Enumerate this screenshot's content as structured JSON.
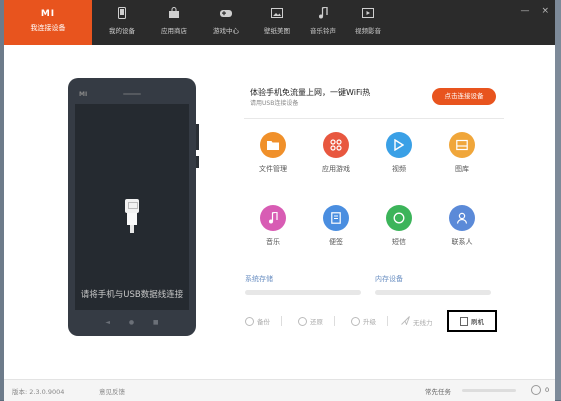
{
  "brand": {
    "logo": "MI",
    "name": "我连接设备"
  },
  "tabs": [
    {
      "label": "我的设备",
      "icon": "phone-icon"
    },
    {
      "label": "应用商店",
      "icon": "shopping-bag-icon"
    },
    {
      "label": "游戏中心",
      "icon": "gamepad-icon"
    },
    {
      "label": "壁纸美图",
      "icon": "picture-icon"
    },
    {
      "label": "音乐铃声",
      "icon": "music-note-icon"
    },
    {
      "label": "视频影音",
      "icon": "video-icon"
    }
  ],
  "window_controls": {
    "minimize": "—",
    "close": "×"
  },
  "phone": {
    "mi_logo": "MI",
    "hint": "请将手机与USB数据线连接",
    "nav": [
      "◄",
      "●",
      "■"
    ]
  },
  "wifi": {
    "title": "体验手机免流量上网，一键WiFi热",
    "subtitle": "请用USB连接设备",
    "connect_button": "点击连接设备"
  },
  "features": [
    {
      "label": "文件管理",
      "icon": "folder-icon",
      "color": "#f0902a"
    },
    {
      "label": "应用游戏",
      "icon": "apps-icon",
      "color": "#e8573f"
    },
    {
      "label": "视频",
      "icon": "play-icon",
      "color": "#3aa0e6"
    },
    {
      "label": "图库",
      "icon": "gallery-icon",
      "color": "#f0a63a"
    },
    {
      "label": "音乐",
      "icon": "music-icon",
      "color": "#d85cb4"
    },
    {
      "label": "便签",
      "icon": "note-icon",
      "color": "#4a8ee0"
    },
    {
      "label": "短信",
      "icon": "message-icon",
      "color": "#3cb45a"
    },
    {
      "label": "联系人",
      "icon": "contact-icon",
      "color": "#5b8ad8"
    }
  ],
  "storage": {
    "system_label": "系统存储",
    "internal_label": "内存设备"
  },
  "tools": [
    {
      "label": "备份",
      "icon": "backup-icon"
    },
    {
      "label": "还原",
      "icon": "restore-icon"
    },
    {
      "label": "升级",
      "icon": "upgrade-icon"
    },
    {
      "label": "无线力",
      "icon": "wireless-icon"
    }
  ],
  "flash": {
    "label": "刷机",
    "icon": "flash-icon"
  },
  "status": {
    "version": "版本: 2.3.0.9004",
    "feedback": "意见反馈",
    "tasks_label": "常先任务",
    "tasks_count": "0"
  }
}
